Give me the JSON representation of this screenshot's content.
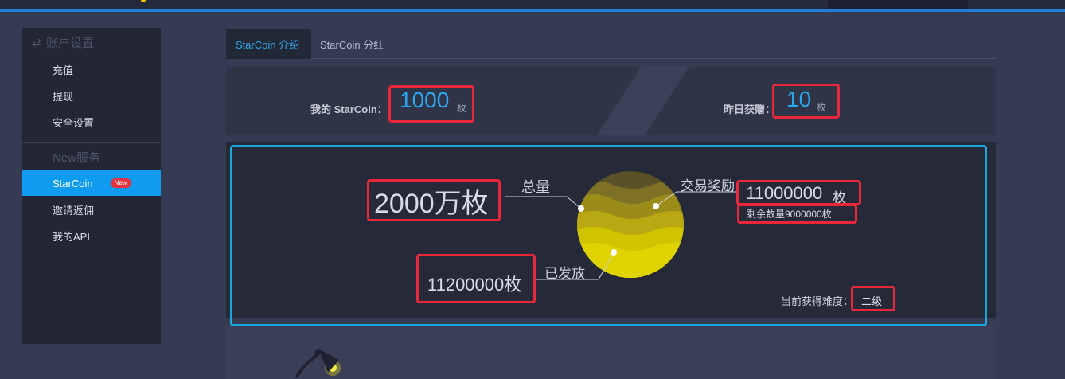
{
  "sidebar": {
    "account_section": "账户设置",
    "account_items": [
      "充值",
      "提现",
      "安全设置"
    ],
    "new_section": "New服务",
    "new_items": [
      "StarCoin",
      "邀请返佣",
      "我的API"
    ],
    "new_badge": "New"
  },
  "tabs": [
    "StarCoin 介绍",
    "StarCoin 分红"
  ],
  "stats": {
    "my_label": "我的 StarCoin：",
    "my_value": "1000",
    "my_unit": "枚",
    "yesterday_label": "昨日获赠：",
    "yesterday_value": "10",
    "yesterday_unit": "枚"
  },
  "coin": {
    "total_value": "2000万枚",
    "total_label": "总量",
    "trade_label": "交易奖励",
    "trade_value": "11000000",
    "trade_unit": "枚",
    "remaining": "剩余数量9000000枚",
    "issued_value": "11200000枚",
    "issued_label": "已发放",
    "difficulty_label": "当前获得难度：",
    "difficulty_value": "二级"
  },
  "colors": {
    "accent_blue": "#0f9bf0",
    "highlight_red": "#e8283a",
    "highlight_cyan": "#1aa8dc",
    "coin_yellow": "#e0d400"
  }
}
